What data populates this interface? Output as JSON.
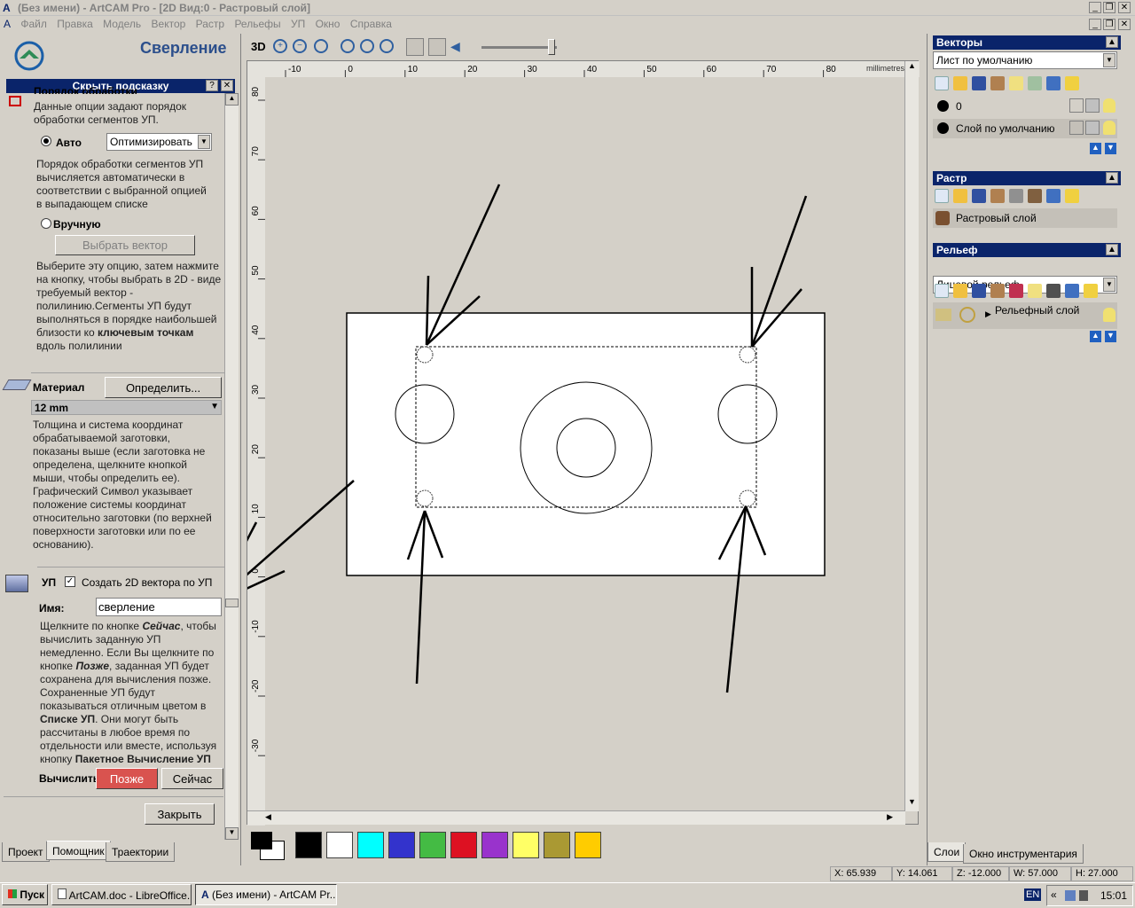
{
  "window": {
    "title": "(Без имени) - ArtCAM Pro - [2D Вид:0 - Растровый слой]"
  },
  "menu": [
    "Файл",
    "Правка",
    "Модель",
    "Вектор",
    "Растр",
    "Рельефы",
    "УП",
    "Окно",
    "Справка"
  ],
  "left_panel": {
    "title": "Сверление",
    "hint_bar": "Скрыть подсказку",
    "order_heading": "Порядок обработки",
    "order_desc": "Данные опции задают порядок обработки сегментов УП.",
    "auto_label": "Авто",
    "auto_option": "Оптимизировать",
    "auto_desc": "Порядок обработки сегментов УП вычисляется автоматически в соответствии с выбранной опцией в выпадающем списке",
    "manual_label": "Вручную",
    "select_vector_btn": "Выбрать вектор",
    "manual_desc_a": "Выберите эту опцию, затем нажмите на кнопку, чтобы выбрать в 2D - виде требуемый вектор - полилинию.Сегменты УП будут выполняться в порядке наибольшей близости ко",
    "manual_desc_bold": "ключевым точкам",
    "manual_desc_b": "вдоль полилинии",
    "material_label": "Материал",
    "define_btn": "Определить...",
    "material_value": "12 mm",
    "material_desc": "Толщина и система координат обрабатываемой заготовки, показаны выше (если заготовка не определена, щелкните кнопкой мыши, чтобы определить ее). Графический Символ указывает положение системы координат относительно заготовки (по верхней поверхности заготовки или по ее основанию).",
    "up_label": "УП",
    "create_2d": "Создать 2D вектора по УП",
    "name_label": "Имя:",
    "name_value": "сверление",
    "calc_p1": "Щелкните по кнопке ",
    "calc_now_i": "Сейчас",
    "calc_p2": ", чтобы вычислить заданную УП немедленно. Если Вы щелкните по кнопке ",
    "calc_later_i": "Позже",
    "calc_p3": ", заданная УП будет сохранена для вычисления позже. Сохраненные УП будут показываться отличным цветом в ",
    "calc_list_b": "Списке УП",
    "calc_p4": ". Они могут быть рассчитаны в любое время по отдельности или вместе, используя кнопку ",
    "calc_batch_b": "Пакетное Вычисление УП",
    "calc_label": "Вычислить",
    "later_btn": "Позже",
    "now_btn": "Сейчас",
    "close_btn": "Закрыть",
    "tabs": [
      "Проект",
      "Помощник",
      "Траектории"
    ]
  },
  "view": {
    "mode_3d": "3D",
    "ruler_unit": "millimetres",
    "h_ticks": [
      "-10",
      "0",
      "10",
      "20",
      "30",
      "40",
      "50",
      "60",
      "70",
      "80"
    ],
    "v_ticks": [
      "80",
      "70",
      "60",
      "50",
      "40",
      "30",
      "20",
      "10",
      "0",
      "-10",
      "-20",
      "-30"
    ]
  },
  "colors": {
    "palette": [
      "#000000",
      "#ffffff",
      "#00ffff",
      "#3333cc",
      "#44bb44",
      "#dd1122",
      "#9933cc",
      "#ffff66",
      "#aa9933",
      "#ffcc00"
    ],
    "later_button": "#d9534f",
    "panel_header": "#0a246a"
  },
  "right_panel": {
    "vectors_title": "Векторы",
    "vectors_sheet": "Лист по умолчанию",
    "layer_0": "0",
    "layer_default": "Слой по умолчанию",
    "raster_title": "Растр",
    "raster_layer": "Растровый слой",
    "relief_title": "Рельеф",
    "relief_select": "Лицевой рельеф",
    "relief_layer": "Рельефный слой",
    "tabs": [
      "Слои",
      "Окно инструментария"
    ]
  },
  "statusbar": {
    "x": "X: 65.939",
    "y": "Y: 14.061",
    "z": "Z: -12.000",
    "w": "W: 57.000",
    "h": "H: 27.000"
  },
  "taskbar": {
    "start": "Пуск",
    "items": [
      "ArtCAM.doc - LibreOffice...",
      "(Без имени) - ArtCAM Pr..."
    ],
    "lang": "EN",
    "time": "15:01"
  }
}
